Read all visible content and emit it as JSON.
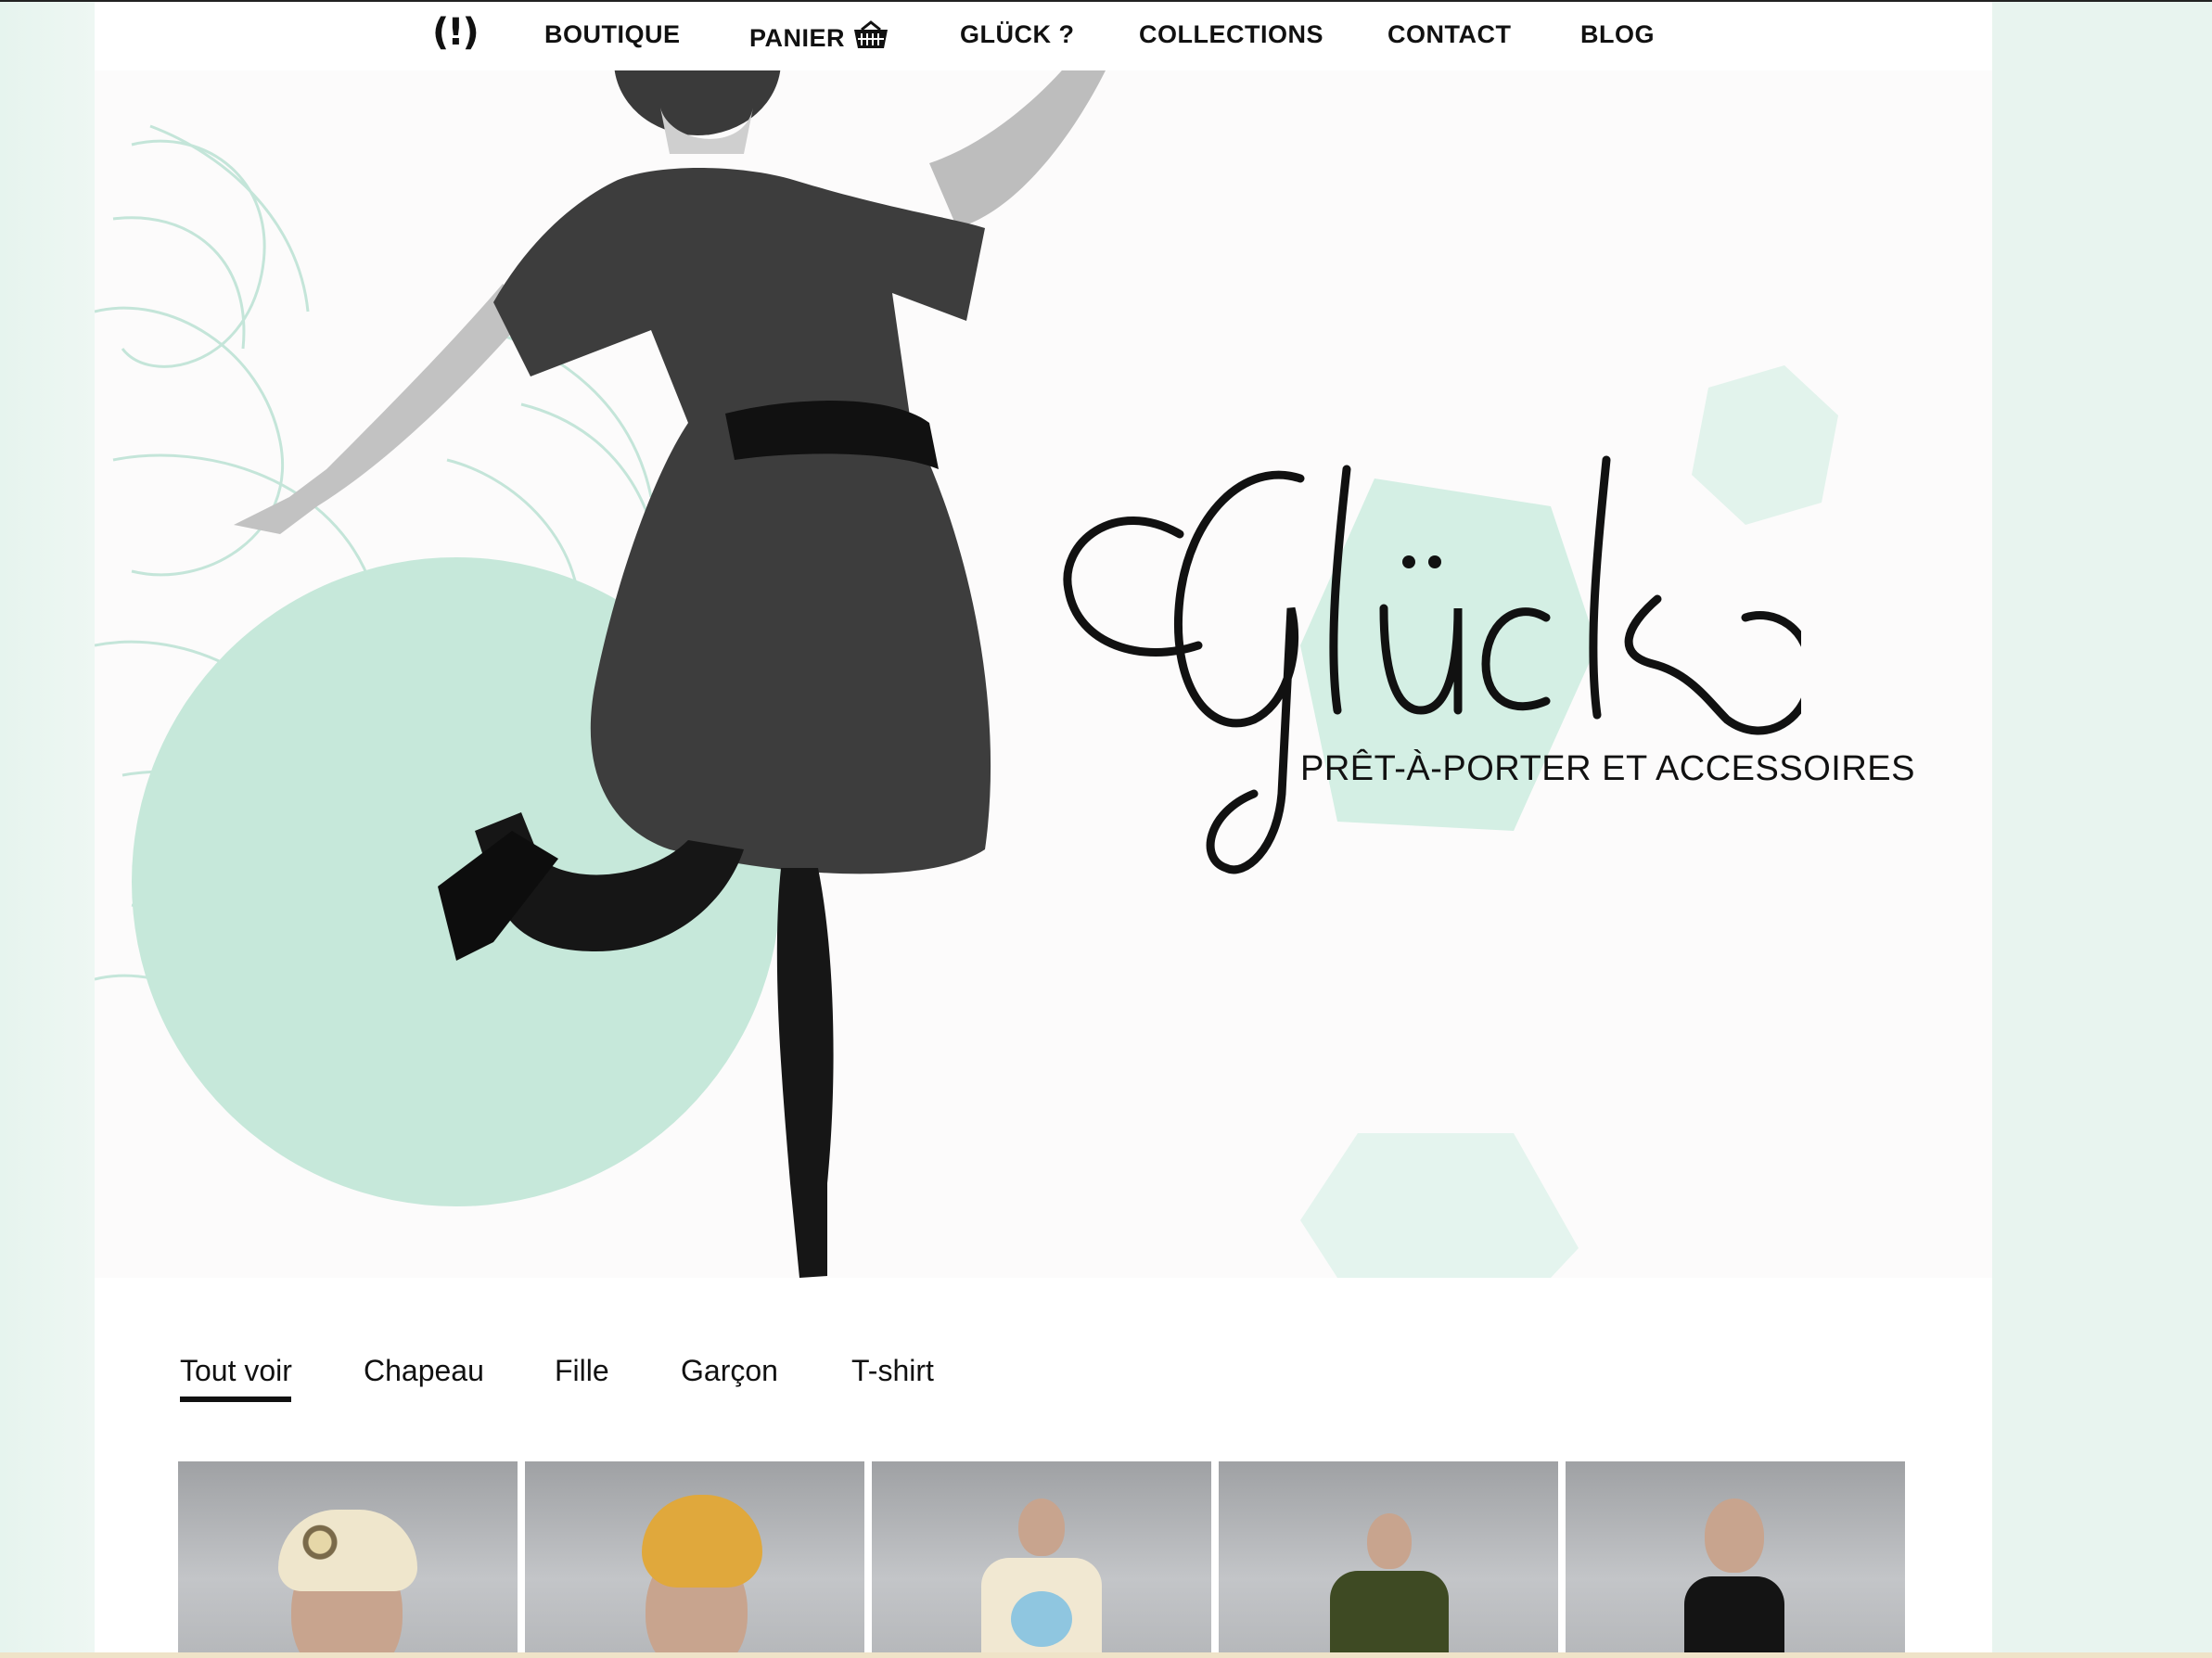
{
  "nav": {
    "logo_mark": "(!)",
    "items": [
      {
        "label": "BOUTIQUE"
      },
      {
        "label": "PANIER"
      },
      {
        "label": "GLÜCK ?"
      },
      {
        "label": "COLLECTIONS"
      },
      {
        "label": "CONTACT"
      },
      {
        "label": "BLOG"
      }
    ],
    "basket_icon": "basket-icon"
  },
  "hero": {
    "brand_name": "Glück",
    "brand_mark": "(!)",
    "tagline": "PRÊT-À-PORTER ET ACCESSOIRES"
  },
  "filters": {
    "tabs": [
      {
        "label": "Tout voir",
        "active": true
      },
      {
        "label": "Chapeau",
        "active": false
      },
      {
        "label": "Fille",
        "active": false
      },
      {
        "label": "Garçon",
        "active": false
      },
      {
        "label": "T-shirt",
        "active": false
      }
    ]
  },
  "products": [
    {
      "name": "product-turban-floral"
    },
    {
      "name": "product-turban-mustard"
    },
    {
      "name": "product-tshirt-print"
    },
    {
      "name": "product-tshirt-khaki"
    },
    {
      "name": "product-tank-black"
    }
  ],
  "colors": {
    "accent_mint": "#bfe6d7",
    "accent_mint_light": "#e2f3ec",
    "text": "#111111"
  }
}
